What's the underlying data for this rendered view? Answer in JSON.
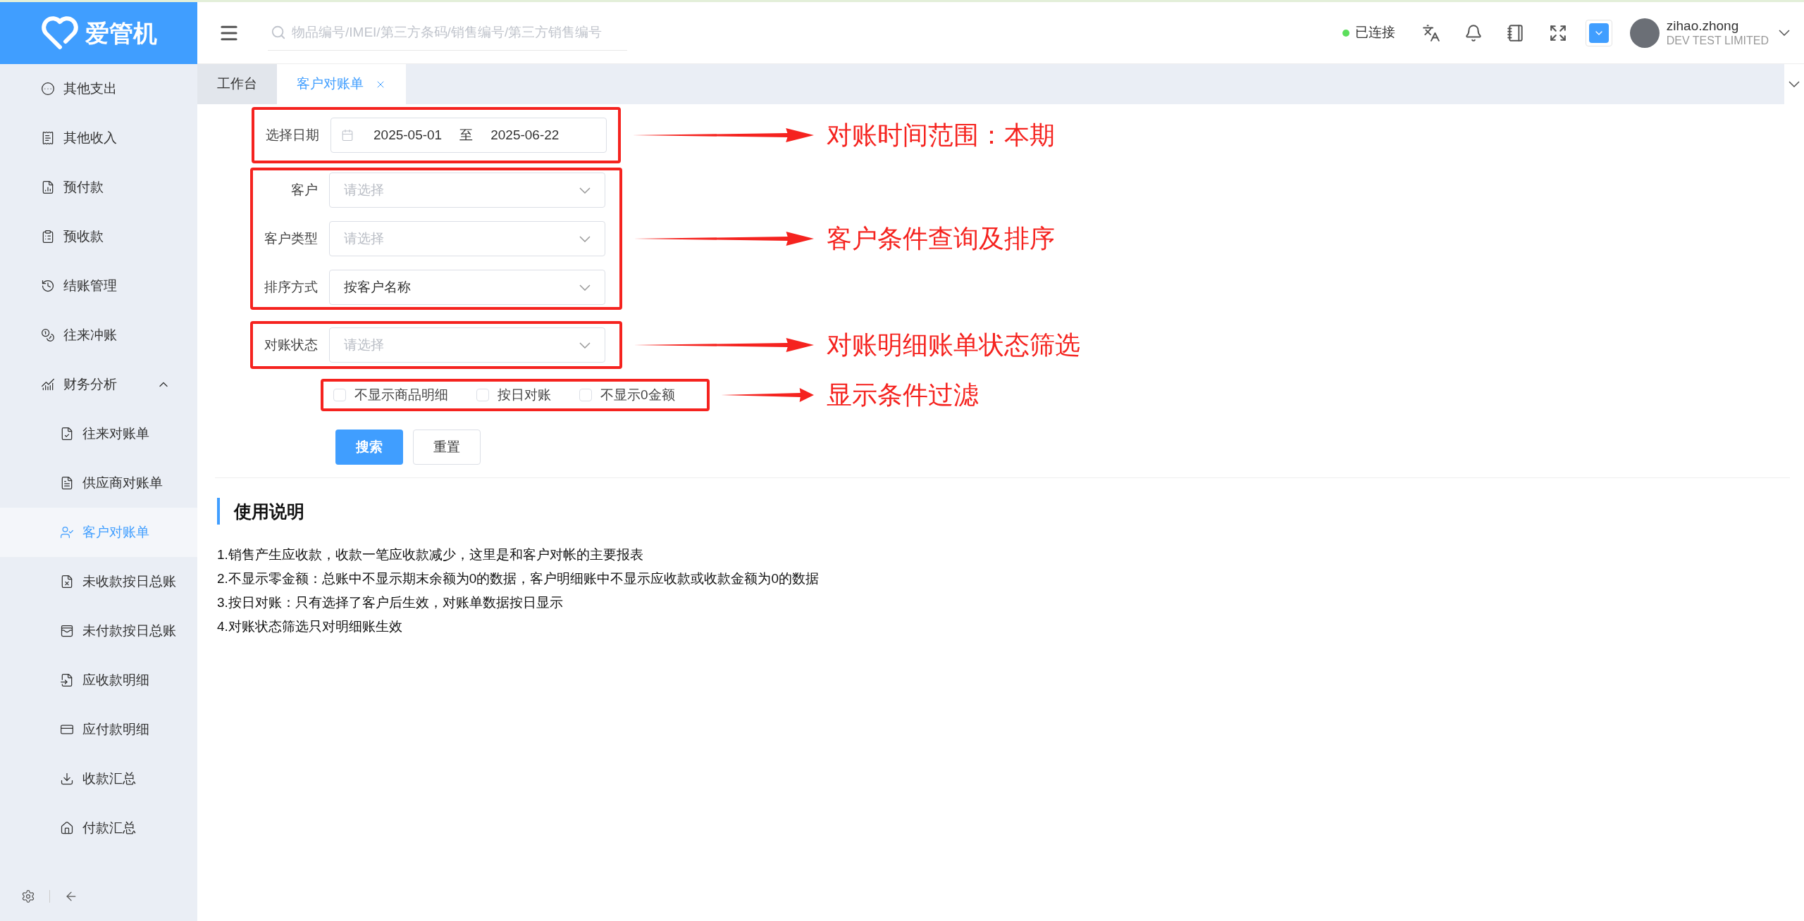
{
  "app": {
    "name": "爱管机"
  },
  "sidebar": {
    "items": [
      {
        "label": "其他支出",
        "selected": false
      },
      {
        "label": "其他收入",
        "selected": false
      },
      {
        "label": "预付款",
        "selected": false
      },
      {
        "label": "预收款",
        "selected": false
      },
      {
        "label": "结账管理",
        "selected": false
      },
      {
        "label": "往来冲账",
        "selected": false
      },
      {
        "label": "财务分析",
        "selected": false,
        "expanded": true,
        "children": [
          {
            "label": "往来对账单",
            "selected": false
          },
          {
            "label": "供应商对账单",
            "selected": false
          },
          {
            "label": "客户对账单",
            "selected": true
          },
          {
            "label": "未收款按日总账",
            "selected": false
          },
          {
            "label": "未付款按日总账",
            "selected": false
          },
          {
            "label": "应收款明细",
            "selected": false
          },
          {
            "label": "应付款明细",
            "selected": false
          },
          {
            "label": "收款汇总",
            "selected": false
          },
          {
            "label": "付款汇总",
            "selected": false
          }
        ]
      }
    ]
  },
  "header": {
    "search": {
      "placeholder": "物品编号/IMEI/第三方条码/销售编号/第三方销售编号"
    },
    "status": {
      "label": "已连接",
      "connected": true
    },
    "user": {
      "name": "zihao.zhong",
      "company": "DEV TEST LIMITED"
    }
  },
  "tabs": [
    {
      "label": "工作台",
      "selected": false,
      "closable": false
    },
    {
      "label": "客户对账单",
      "selected": true,
      "closable": true
    }
  ],
  "form": {
    "groups": [
      {
        "annotation": "对账时间范围：本期",
        "fields": [
          {
            "kind": "date_range",
            "label": "选择日期",
            "start": "2025-05-01",
            "separator": "至",
            "end": "2025-06-22"
          }
        ]
      },
      {
        "annotation": "客户条件查询及排序",
        "fields": [
          {
            "kind": "select",
            "label": "客户",
            "placeholder": "请选择"
          },
          {
            "kind": "select",
            "label": "客户类型",
            "placeholder": "请选择"
          },
          {
            "kind": "select",
            "label": "排序方式",
            "value": "按客户名称"
          }
        ]
      },
      {
        "annotation": "对账明细账单状态筛选",
        "fields": [
          {
            "kind": "select",
            "label": "对账状态",
            "placeholder": "请选择"
          }
        ]
      },
      {
        "annotation": "显示条件过滤",
        "fields": [
          {
            "kind": "checkboxes",
            "options": [
              {
                "label": "不显示商品明细",
                "checked": false
              },
              {
                "label": "按日对账",
                "checked": false
              },
              {
                "label": "不显示0金额",
                "checked": false
              }
            ]
          }
        ]
      }
    ],
    "buttons": [
      {
        "label": "搜索",
        "kind": "primary"
      },
      {
        "label": "重置",
        "kind": "default"
      }
    ]
  },
  "instructions": {
    "title": "使用说明",
    "lines": [
      "1.销售产生应收款，收款一笔应收款减少，这里是和客户对帐的主要报表",
      "2.不显示零金额：总账中不显示期末余额为0的数据，客户明细账中不显示应收款或收款金额为0的数据",
      "3.按日对账：只有选择了客户后生效，对账单数据按日显示",
      "4.对账状态筛选只对明细账生效"
    ]
  }
}
